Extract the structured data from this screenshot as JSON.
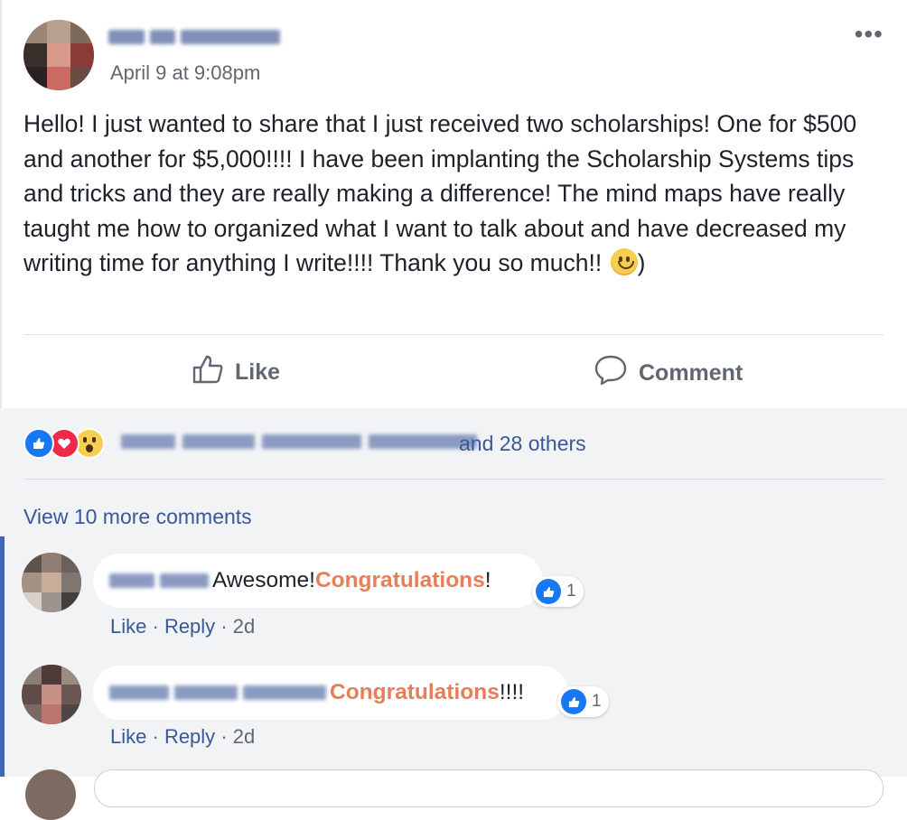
{
  "post": {
    "timestamp": "April 9 at 9:08pm",
    "more_icon": "ellipsis-icon",
    "text": "Hello! I just wanted to share that I just received two scholarships! One for $500 and another for $5,000!!!! I have been implanting the Scholarship Systems tips and tricks and they are really making a difference! The mind maps have really taught me how to organized what I want to talk about and have decreased my writing time for anything I write!!!! Thank you so much!! ",
    "text_end": ")"
  },
  "actions": {
    "like_label": "Like",
    "comment_label": "Comment"
  },
  "reactions": {
    "types": [
      "like",
      "love",
      "wow"
    ],
    "summary_suffix": "and 28 others"
  },
  "comments_section": {
    "view_more": "View 10 more comments",
    "comments": [
      {
        "text": "Awesome! ",
        "highlight": "Congratulations",
        "suffix": "!",
        "like_count": "1",
        "like_action": "Like",
        "reply_action": "Reply",
        "separator": "·",
        "time": "2d"
      },
      {
        "text": "",
        "highlight": "Congratulations",
        "suffix": "!!!!",
        "like_count": "1",
        "like_action": "Like",
        "reply_action": "Reply",
        "separator": "·",
        "time": "2d"
      }
    ]
  },
  "colors": {
    "link": "#385898",
    "highlight": "#e67e5a",
    "like_blue": "#1877f2",
    "comment_bg": "#f2f3f5"
  }
}
